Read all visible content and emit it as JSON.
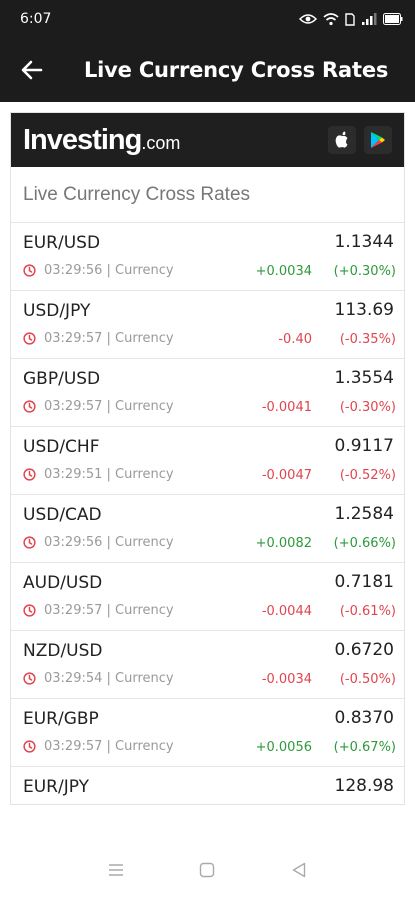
{
  "status": {
    "time": "6:07"
  },
  "app_bar": {
    "title": "Live Currency Cross Rates"
  },
  "widget": {
    "brand": {
      "name": "Investing",
      "tld": ".com"
    },
    "section_title": "Live Currency Cross Rates",
    "rows": [
      {
        "pair": "EUR/USD",
        "value": "1.1344",
        "time": "03:29:56",
        "category": "Currency",
        "change": "+0.0034",
        "percent": "(+0.30%)",
        "direction": "up"
      },
      {
        "pair": "USD/JPY",
        "value": "113.69",
        "time": "03:29:57",
        "category": "Currency",
        "change": "-0.40",
        "percent": "(-0.35%)",
        "direction": "down"
      },
      {
        "pair": "GBP/USD",
        "value": "1.3554",
        "time": "03:29:57",
        "category": "Currency",
        "change": "-0.0041",
        "percent": "(-0.30%)",
        "direction": "down"
      },
      {
        "pair": "USD/CHF",
        "value": "0.9117",
        "time": "03:29:51",
        "category": "Currency",
        "change": "-0.0047",
        "percent": "(-0.52%)",
        "direction": "down"
      },
      {
        "pair": "USD/CAD",
        "value": "1.2584",
        "time": "03:29:56",
        "category": "Currency",
        "change": "+0.0082",
        "percent": "(+0.66%)",
        "direction": "up"
      },
      {
        "pair": "AUD/USD",
        "value": "0.7181",
        "time": "03:29:57",
        "category": "Currency",
        "change": "-0.0044",
        "percent": "(-0.61%)",
        "direction": "down"
      },
      {
        "pair": "NZD/USD",
        "value": "0.6720",
        "time": "03:29:54",
        "category": "Currency",
        "change": "-0.0034",
        "percent": "(-0.50%)",
        "direction": "down"
      },
      {
        "pair": "EUR/GBP",
        "value": "0.8370",
        "time": "03:29:57",
        "category": "Currency",
        "change": "+0.0056",
        "percent": "(+0.67%)",
        "direction": "up"
      },
      {
        "pair": "EUR/JPY",
        "value": "128.98",
        "time": "",
        "category": "",
        "change": "",
        "percent": "",
        "direction": "up"
      }
    ]
  },
  "colors": {
    "up": "#2e9a3a",
    "down": "#e0454f",
    "header_bg": "#1c1c1c"
  },
  "icons": {
    "back": "arrow-left-icon",
    "apple": "apple-icon",
    "play": "google-play-icon",
    "clock": "clock-icon",
    "nav_menu": "menu-icon",
    "nav_home": "home-icon",
    "nav_back": "back-triangle-icon"
  }
}
